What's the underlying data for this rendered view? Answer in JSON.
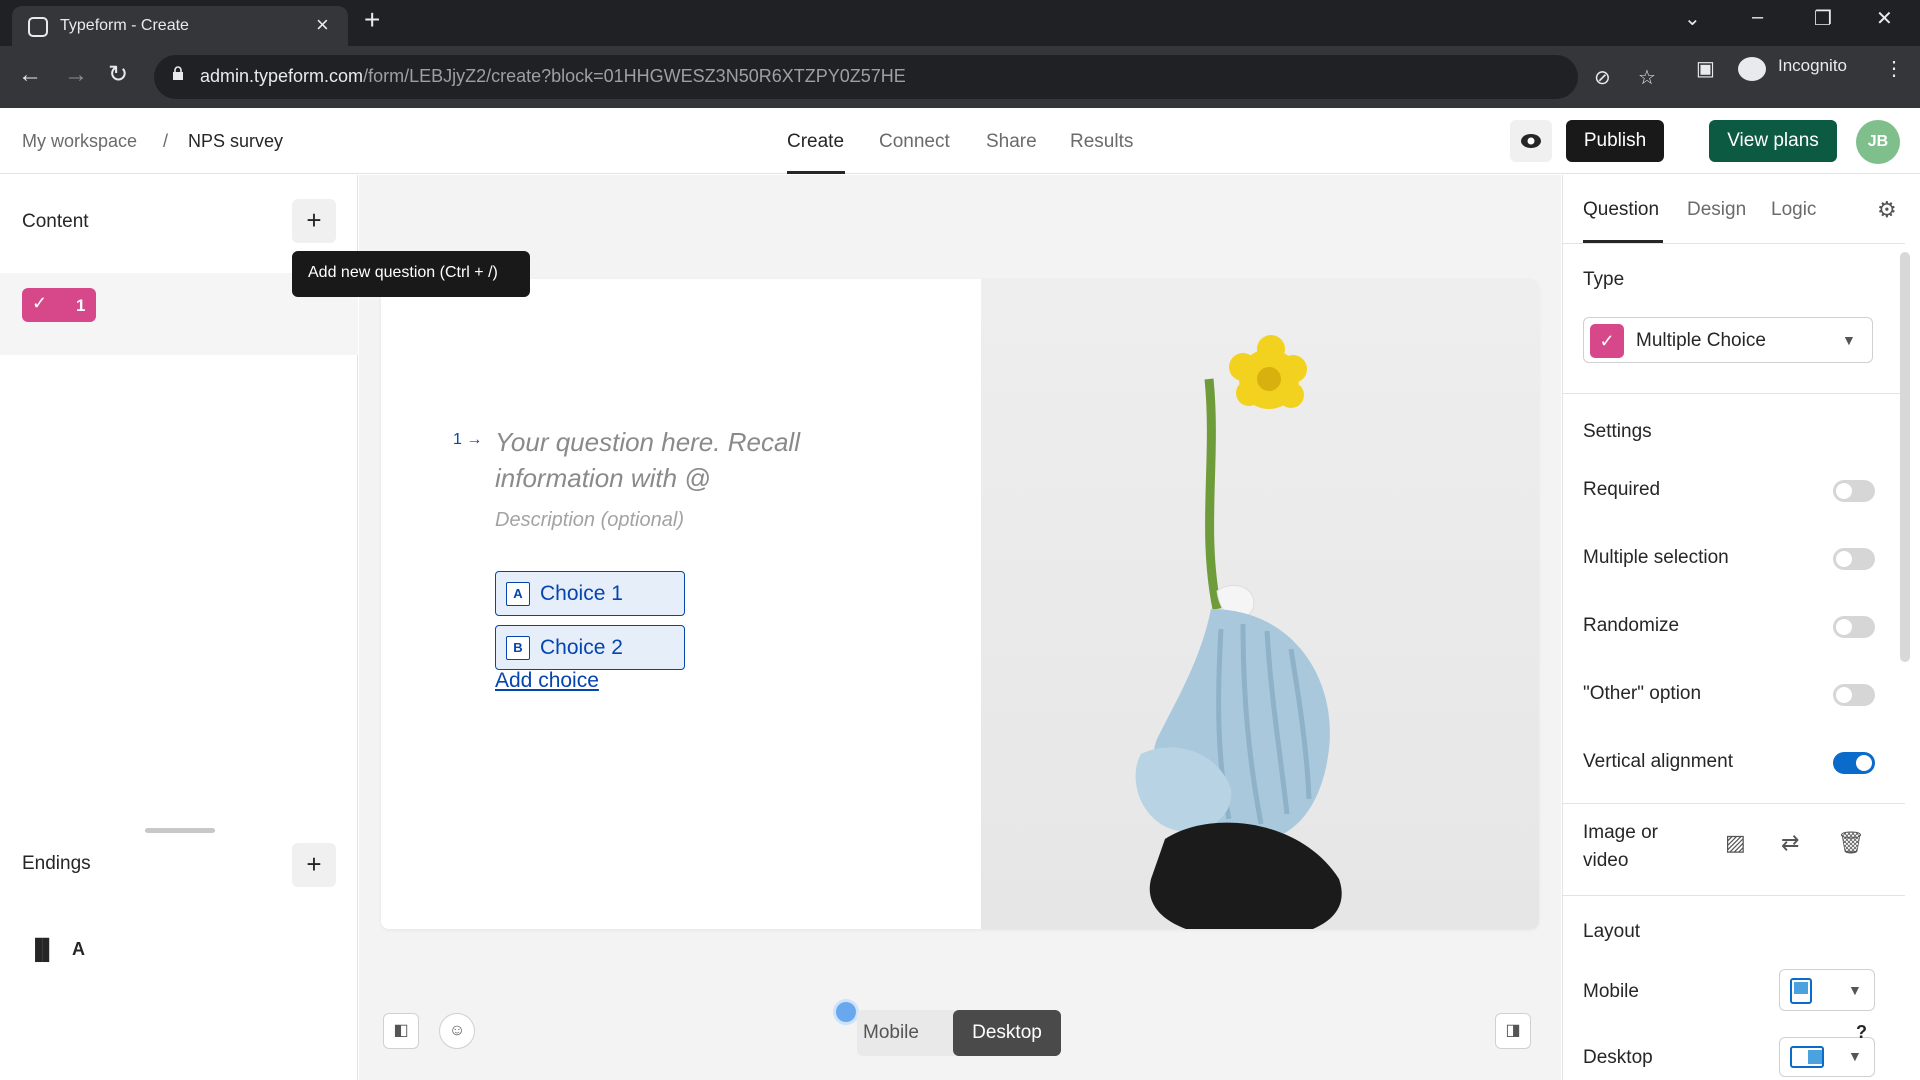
{
  "browser": {
    "tab_title": "Typeform - Create",
    "url_domain": "admin.typeform.com",
    "url_path": "/form/LEBJjyZ2/create?block=01HHGWESZ3N50R6XTZPY0Z57HE",
    "profile": "Incognito"
  },
  "header": {
    "breadcrumb": [
      "My workspace",
      "/",
      "NPS survey"
    ],
    "tabs": [
      "Create",
      "Connect",
      "Share",
      "Results"
    ],
    "active_tab": "Create",
    "publish_label": "Publish",
    "plans_label": "View plans",
    "avatar_initials": "JB"
  },
  "left_panel": {
    "content_title": "Content",
    "tooltip": "Add new question (Ctrl + /)",
    "question_number": "1",
    "endings_title": "Endings",
    "ending_label": "A"
  },
  "canvas": {
    "question_number": "1",
    "question_arrow": "→",
    "question_placeholder": "Your question here. Recall information with @",
    "description_placeholder": "Description (optional)",
    "choices": [
      {
        "key": "A",
        "label": "Choice 1"
      },
      {
        "key": "B",
        "label": "Choice 2"
      }
    ],
    "add_choice": "Add choice",
    "view_modes": [
      "Mobile",
      "Desktop"
    ],
    "active_view": "Desktop"
  },
  "right_panel": {
    "tabs": [
      "Question",
      "Design",
      "Logic"
    ],
    "active_tab": "Question",
    "type_label": "Type",
    "type_value": "Multiple Choice",
    "settings_label": "Settings",
    "settings": [
      {
        "label": "Required",
        "on": false
      },
      {
        "label": "Multiple selection",
        "on": false
      },
      {
        "label": "Randomize",
        "on": false
      },
      {
        "label": "\"Other\" option",
        "on": false
      },
      {
        "label": "Vertical alignment",
        "on": true
      }
    ],
    "image_label": "Image or video",
    "layout_label": "Layout",
    "layout_mobile": "Mobile",
    "layout_desktop": "Desktop",
    "help": "?"
  },
  "colors": {
    "accent_blue": "#0445af",
    "question_pink": "#d7488a",
    "publish_bg": "#191919",
    "plans_green": "#0b5a41",
    "toggle_on": "#0b6bcb"
  }
}
